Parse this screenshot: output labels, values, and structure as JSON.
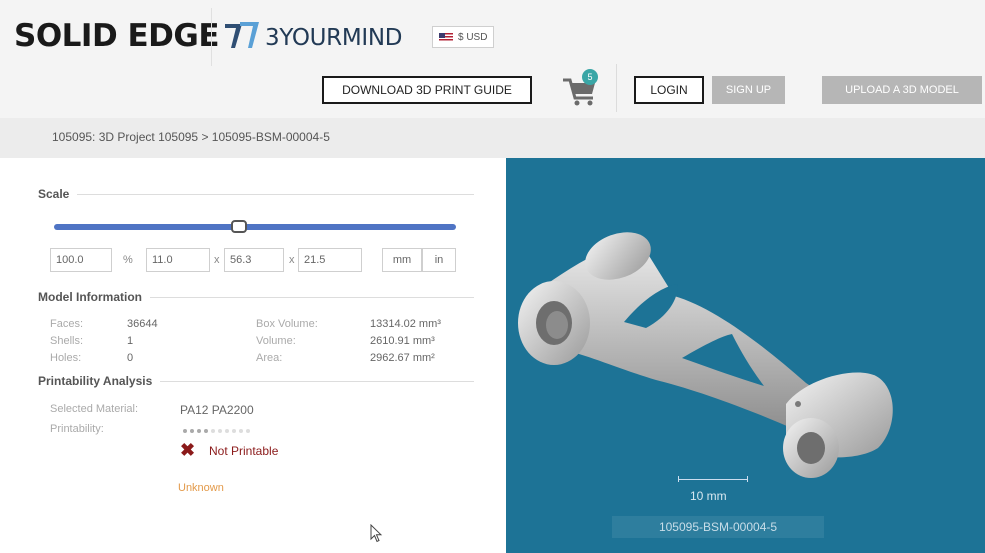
{
  "header": {
    "brand": "SOLID EDGE",
    "partner_logo_text": "3YOURMIND",
    "currency": "$ USD",
    "download_guide": "DOWNLOAD 3D PRINT GUIDE",
    "cart_count": "5",
    "login": "LOGIN",
    "signup": "SIGN UP",
    "upload": "UPLOAD A 3D MODEL"
  },
  "breadcrumb": "105095: 3D Project 105095 > 105095-BSM-00004-5",
  "scale": {
    "title": "Scale",
    "percent_value": "100.0",
    "percent_unit": "%",
    "x_value": "11.0",
    "y_value": "56.3",
    "z_value": "21.5",
    "sep": "x",
    "unit_mm": "mm",
    "unit_in": "in",
    "slider_fraction": 0.46
  },
  "model_info": {
    "title": "Model Information",
    "faces_label": "Faces:",
    "faces": "36644",
    "shells_label": "Shells:",
    "shells": "1",
    "holes_label": "Holes:",
    "holes": "0",
    "box_volume_label": "Box Volume:",
    "box_volume": "13314.02 mm³",
    "volume_label": "Volume:",
    "volume": "2610.91 mm³",
    "area_label": "Area:",
    "area": "2962.67 mm²"
  },
  "printability": {
    "title": "Printability Analysis",
    "material_label": "Selected Material:",
    "material": "PA12 PA2200",
    "printability_label": "Printability:",
    "rating_filled": 4,
    "rating_total": 10,
    "status": "Not Printable",
    "unknown": "Unknown"
  },
  "viewer": {
    "scale_label": "10 mm",
    "model_name": "105095-BSM-00004-5"
  },
  "colors": {
    "viewer_bg": "#1d7396",
    "slider": "#4f74c4",
    "error": "#8b1a1a",
    "warning": "#e39a4a"
  }
}
